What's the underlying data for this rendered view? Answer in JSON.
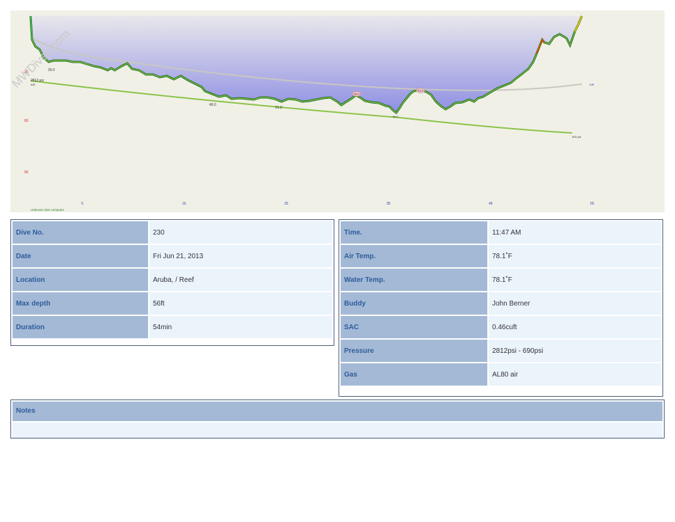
{
  "watermark": "MWDives.com",
  "profile": {
    "start_pressure": "2812 psi",
    "start_gas": "AIR",
    "end_pressure": "690 psi",
    "end_gas": "AIR",
    "computer": "Unknown dive computer",
    "depth_ticks": [
      "30",
      "60",
      "90"
    ],
    "time_ticks": [
      "5",
      "15",
      "25",
      "35",
      "45",
      "55"
    ],
    "temp_labels": [
      "29.0",
      "49.0",
      "51.0",
      "56.0",
      "45.0",
      "51.0"
    ],
    "colors": {
      "background": "#f1f0e6",
      "depth_fill_top": "#e8e7ec",
      "depth_fill_bottom": "#8f8fe3",
      "depth_line": "#156b1a",
      "pressure_line": "#8bc34a",
      "temp_line": "#c9c7c0",
      "ascent_warning": "#e6c200",
      "tick_depth": "#cc2222",
      "tick_time": "#2a3fb0"
    }
  },
  "details": {
    "rows": [
      {
        "label": "Dive No.",
        "value": "230"
      },
      {
        "label": "Date",
        "value": "Fri Jun 21, 2013"
      },
      {
        "label": "Location",
        "value": "Aruba, / Reef"
      },
      {
        "label": "Max depth",
        "value": "56ft"
      },
      {
        "label": "Duration",
        "value": "54min"
      }
    ]
  },
  "conditions": {
    "rows": [
      {
        "label": "Time.",
        "value": "11:47 AM"
      },
      {
        "label": "Air Temp.",
        "value": "78.1˚F"
      },
      {
        "label": "Water Temp.",
        "value": "78.1˚F"
      },
      {
        "label": "Buddy",
        "value": "John Berner"
      },
      {
        "label": "SAC",
        "value": "0.46cuft"
      },
      {
        "label": "Pressure",
        "value": "2812psi - 690psi"
      },
      {
        "label": "Gas",
        "value": "AL80 air"
      }
    ]
  },
  "notes": {
    "label": "Notes",
    "text": ""
  }
}
